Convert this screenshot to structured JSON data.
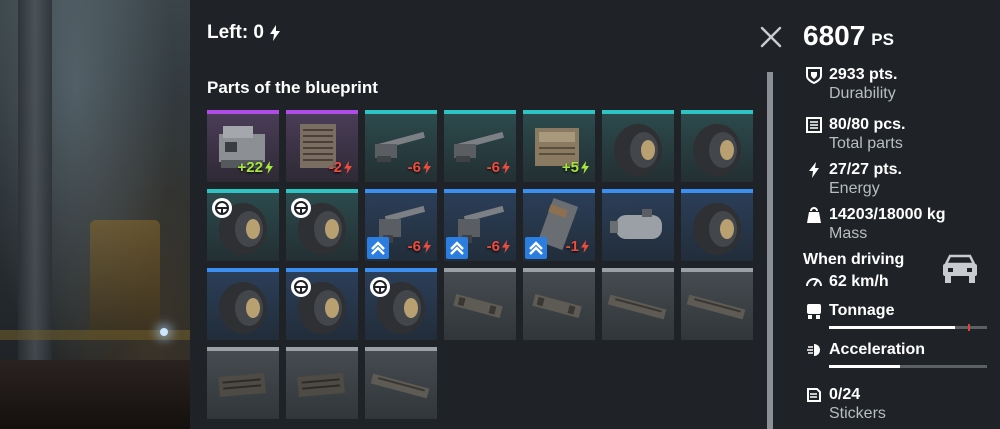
{
  "header": {
    "left_label": "Left: 0",
    "section_title": "Parts of the blueprint"
  },
  "power_score": {
    "value": "6807",
    "unit": "PS"
  },
  "stats": [
    {
      "icon": "shield-icon",
      "value": "2933 pts.",
      "label": "Durability"
    },
    {
      "icon": "parts-list-icon",
      "value": "80/80 pcs.",
      "label": "Total parts"
    },
    {
      "icon": "lightning-icon",
      "value": "27/27 pts.",
      "label": "Energy"
    },
    {
      "icon": "weight-icon",
      "value": "14203/18000 kg",
      "label": "Mass"
    }
  ],
  "driving": {
    "label": "When driving",
    "speed": "62 km/h",
    "tonnage_label": "Tonnage",
    "tonnage_fill": 0.8,
    "tonnage_limit": 0.88,
    "acceleration_label": "Acceleration",
    "acceleration_fill": 0.45
  },
  "stickers": {
    "value": "0/24",
    "label": "Stickers"
  },
  "parts": [
    {
      "name": "Generator",
      "rarity": "epic",
      "icon": "generator-icon",
      "energy": "+22",
      "sign": "pos"
    },
    {
      "name": "Radiator",
      "rarity": "epic",
      "icon": "radiator-icon",
      "energy": "-2",
      "sign": "neg"
    },
    {
      "name": "Cannon",
      "rarity": "special",
      "icon": "cannon-icon",
      "energy": "-6",
      "sign": "neg"
    },
    {
      "name": "Cannon",
      "rarity": "special",
      "icon": "cannon-icon",
      "energy": "-6",
      "sign": "neg"
    },
    {
      "name": "Engine block",
      "rarity": "special",
      "icon": "engine-icon",
      "energy": "+5",
      "sign": "pos"
    },
    {
      "name": "Wheel",
      "rarity": "special",
      "icon": "wheel-icon",
      "energy": "",
      "sign": ""
    },
    {
      "name": "Wheel",
      "rarity": "special",
      "icon": "wheel-icon",
      "energy": "",
      "sign": ""
    },
    {
      "name": "Wheel steering",
      "rarity": "special",
      "icon": "wheel-icon",
      "energy": "",
      "sign": "",
      "tag": "steering-icon"
    },
    {
      "name": "Wheel steering",
      "rarity": "special",
      "icon": "wheel-icon",
      "energy": "",
      "sign": "",
      "tag": "steering-icon"
    },
    {
      "name": "Machine gun",
      "rarity": "rare",
      "icon": "gun-icon",
      "energy": "-6",
      "sign": "neg",
      "upgrade": true
    },
    {
      "name": "Machine gun",
      "rarity": "rare",
      "icon": "gun-icon",
      "energy": "-6",
      "sign": "neg",
      "upgrade": true
    },
    {
      "name": "Module",
      "rarity": "rare",
      "icon": "module-icon",
      "energy": "-1",
      "sign": "neg",
      "upgrade": true
    },
    {
      "name": "Fuel tank",
      "rarity": "rare",
      "icon": "tank-icon",
      "energy": "",
      "sign": ""
    },
    {
      "name": "Wheel",
      "rarity": "rare",
      "icon": "wheel-icon",
      "energy": "",
      "sign": ""
    },
    {
      "name": "Wheel",
      "rarity": "rare",
      "icon": "wheel-icon",
      "energy": "",
      "sign": ""
    },
    {
      "name": "Wheel steering",
      "rarity": "rare",
      "icon": "wheel-icon",
      "energy": "",
      "sign": "",
      "tag": "steering-icon"
    },
    {
      "name": "Wheel steering",
      "rarity": "rare",
      "icon": "wheel-icon",
      "energy": "",
      "sign": "",
      "tag": "steering-icon"
    },
    {
      "name": "Frame",
      "rarity": "common",
      "icon": "frame-icon",
      "energy": "",
      "sign": ""
    },
    {
      "name": "Frame",
      "rarity": "common",
      "icon": "frame-icon",
      "energy": "",
      "sign": ""
    },
    {
      "name": "Frame",
      "rarity": "common",
      "icon": "frame-long-icon",
      "energy": "",
      "sign": ""
    },
    {
      "name": "Frame",
      "rarity": "common",
      "icon": "frame-long-icon",
      "energy": "",
      "sign": ""
    },
    {
      "name": "Frame",
      "rarity": "common",
      "icon": "frame-block-icon",
      "energy": "",
      "sign": ""
    },
    {
      "name": "Frame",
      "rarity": "common",
      "icon": "frame-block-icon",
      "energy": "",
      "sign": ""
    },
    {
      "name": "Frame",
      "rarity": "common",
      "icon": "frame-long-icon",
      "energy": "",
      "sign": ""
    }
  ]
}
